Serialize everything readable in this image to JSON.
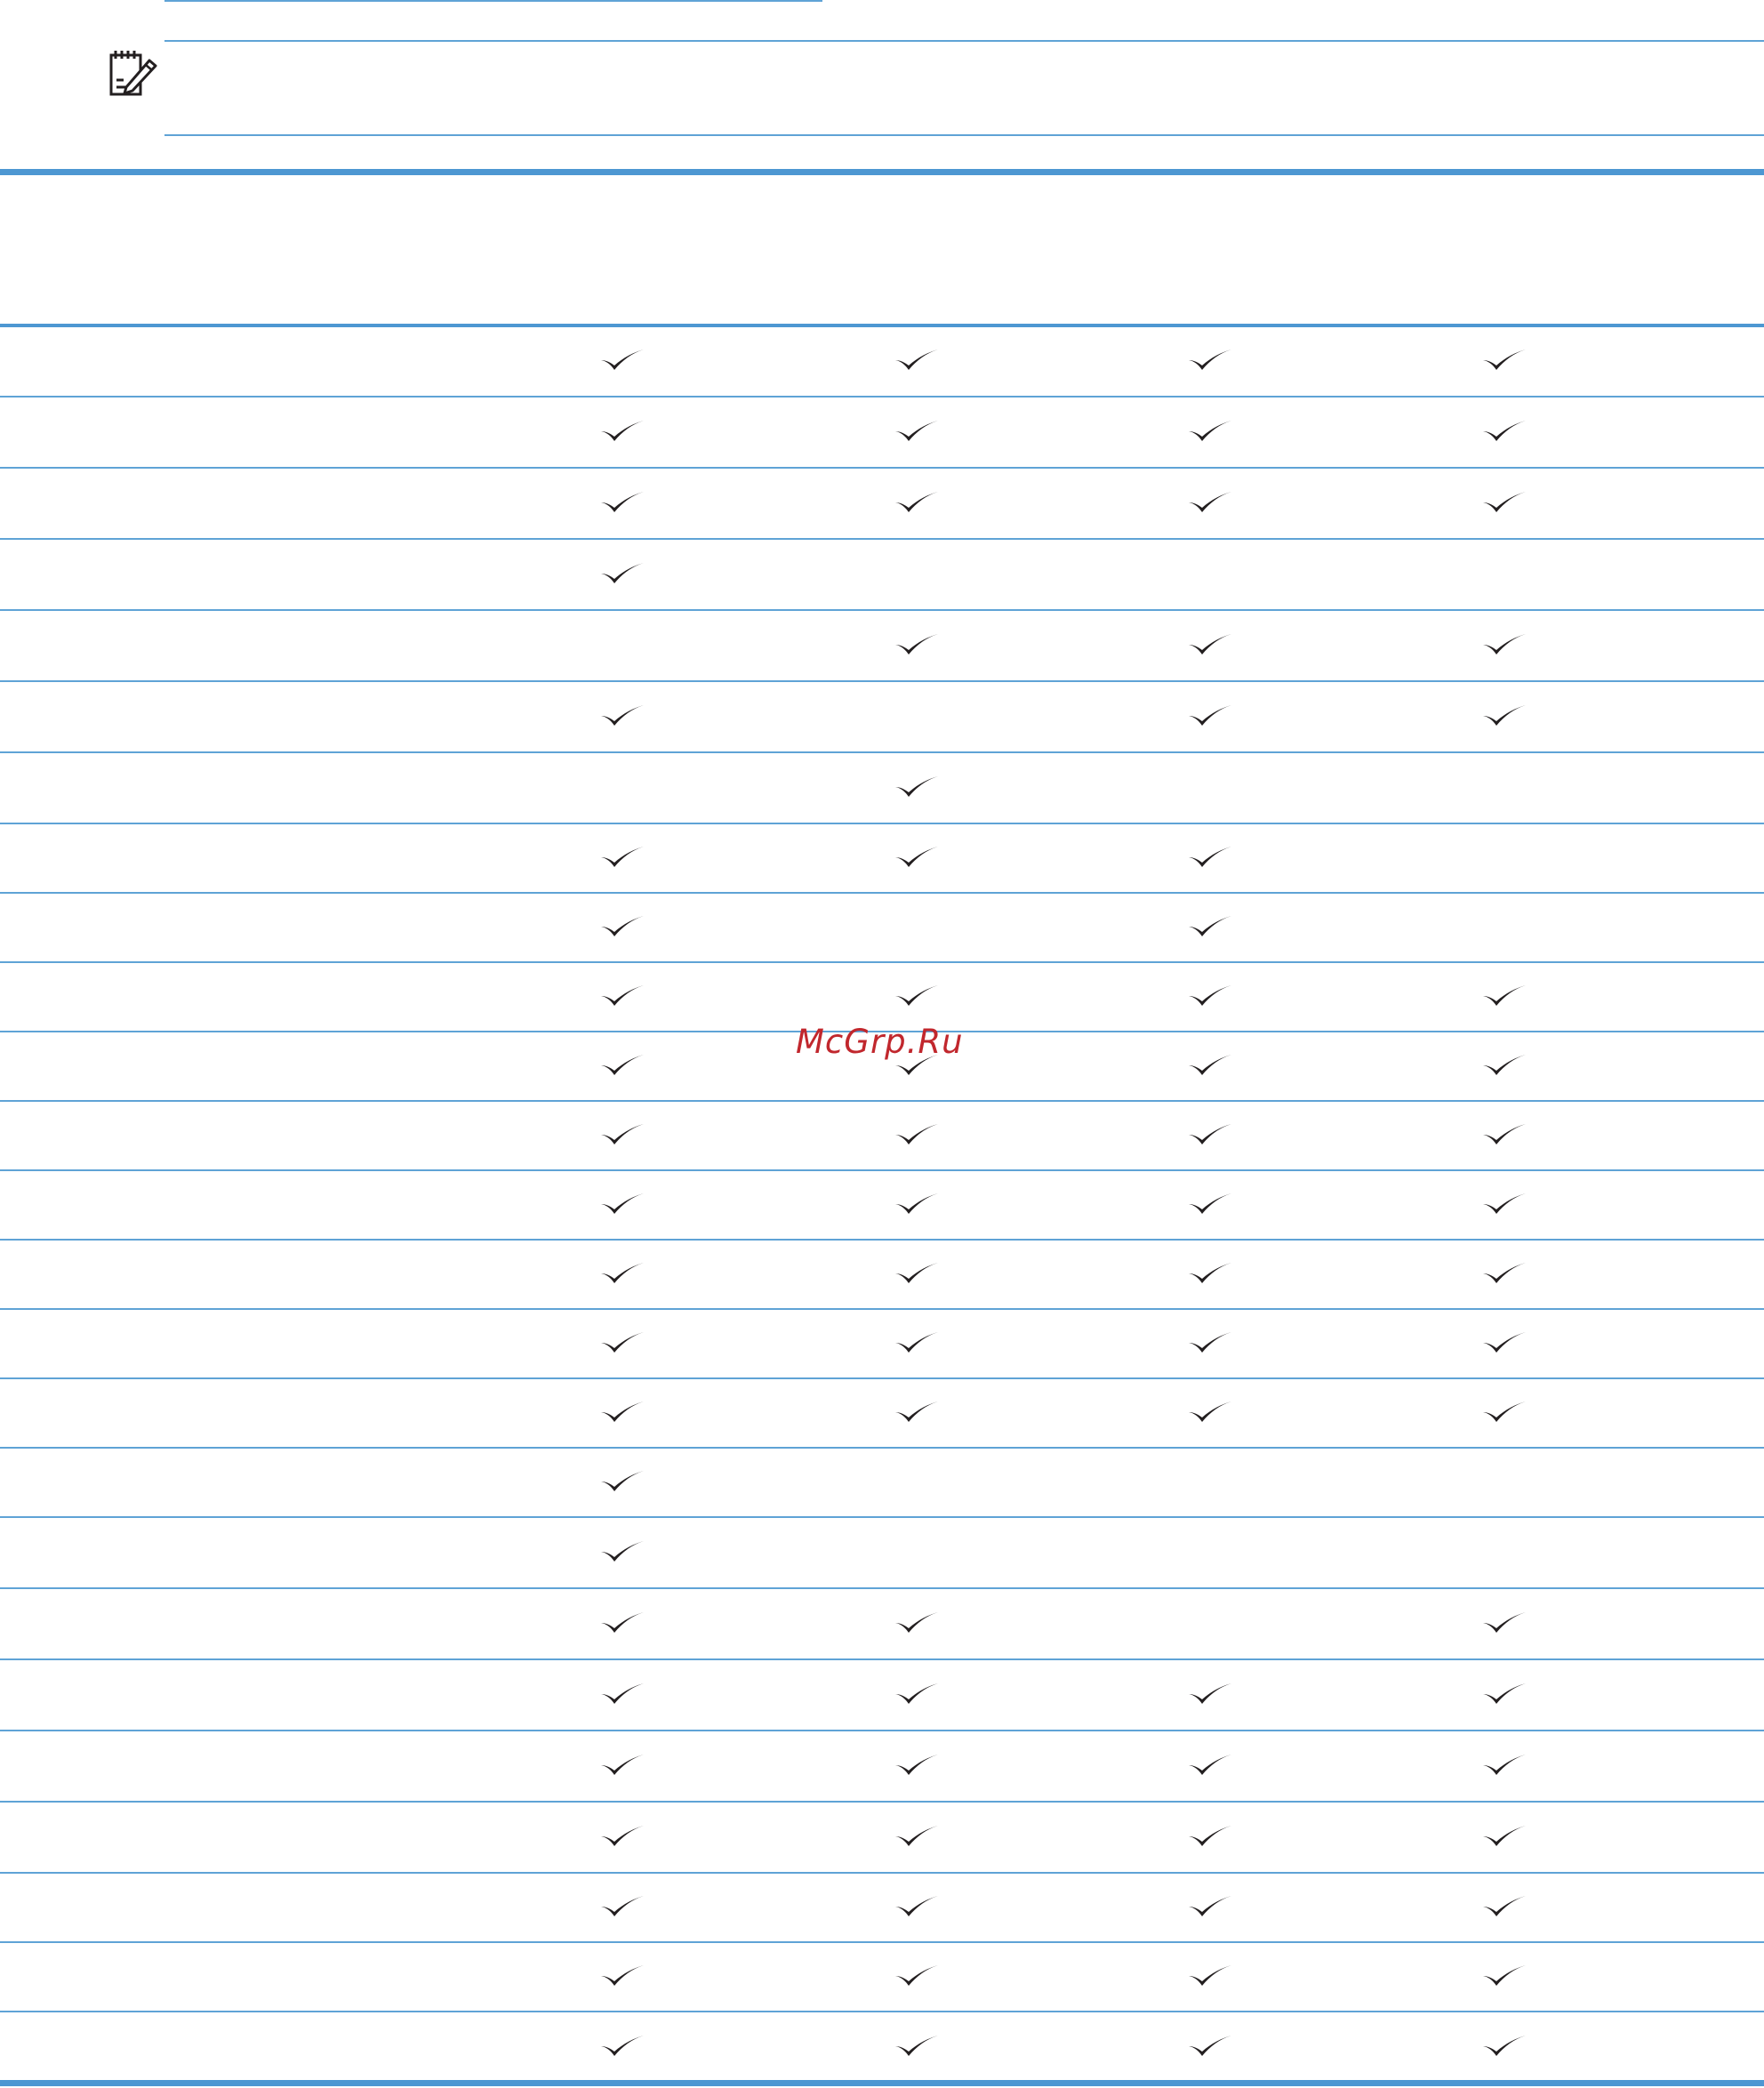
{
  "note": {
    "icon": "note-pad-pencil-icon"
  },
  "watermark": {
    "text": "McGrp.Ru"
  },
  "table": {
    "columns": 4,
    "check_icon": "checkmark-icon",
    "rows": [
      [
        true,
        true,
        true,
        true
      ],
      [
        true,
        true,
        true,
        true
      ],
      [
        true,
        true,
        true,
        true
      ],
      [
        true,
        false,
        false,
        false
      ],
      [
        false,
        true,
        true,
        true
      ],
      [
        true,
        false,
        true,
        true
      ],
      [
        false,
        true,
        false,
        false
      ],
      [
        true,
        true,
        true,
        false
      ],
      [
        true,
        false,
        true,
        false
      ],
      [
        true,
        true,
        true,
        true
      ],
      [
        true,
        true,
        true,
        true
      ],
      [
        true,
        true,
        true,
        true
      ],
      [
        true,
        true,
        true,
        true
      ],
      [
        true,
        true,
        true,
        true
      ],
      [
        true,
        true,
        true,
        true
      ],
      [
        true,
        true,
        true,
        true
      ],
      [
        true,
        false,
        false,
        false
      ],
      [
        true,
        false,
        false,
        false
      ],
      [
        true,
        true,
        false,
        true
      ],
      [
        true,
        true,
        true,
        true
      ],
      [
        true,
        true,
        true,
        true
      ],
      [
        true,
        true,
        true,
        true
      ],
      [
        true,
        true,
        true,
        true
      ],
      [
        true,
        true,
        true,
        true
      ],
      [
        true,
        true,
        true,
        true
      ]
    ]
  }
}
